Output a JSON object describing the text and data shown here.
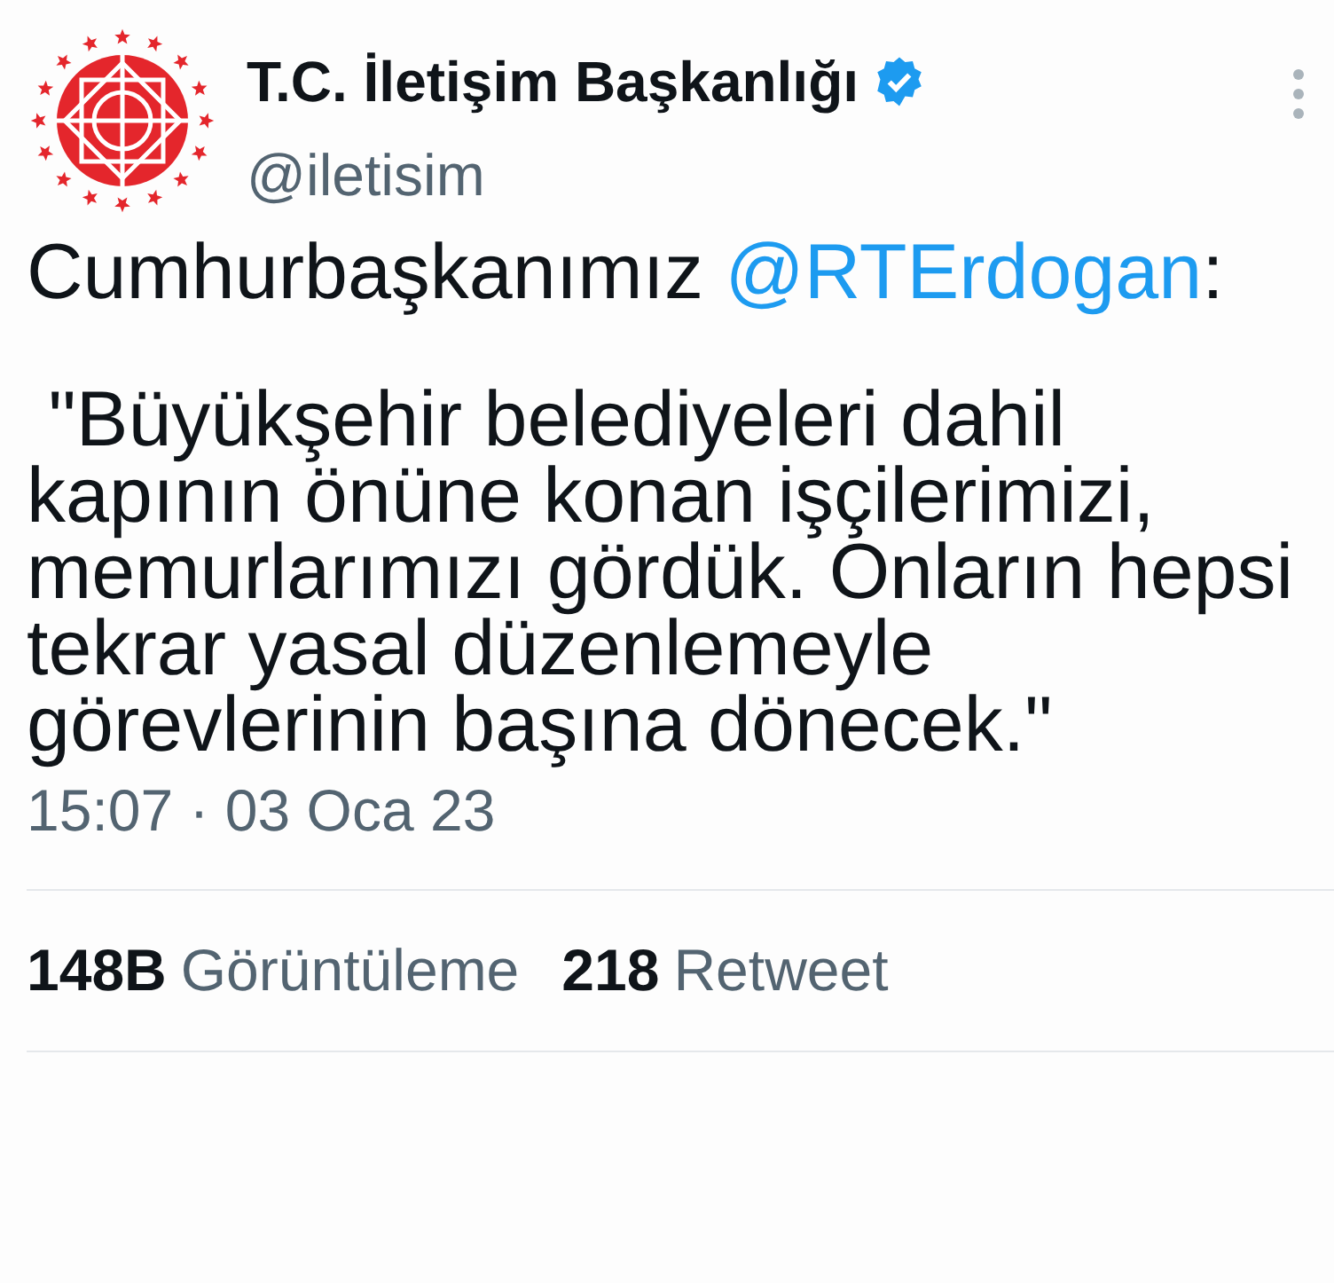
{
  "author": {
    "name": "T.C. İletişim Başkanlığı",
    "verified": true,
    "handle": "@iletisim"
  },
  "tweet": {
    "intro": "Cumhurbaşkanımız ",
    "mention": "@RTErdogan",
    "intro_end": ":",
    "quote": " \"Büyükşehir belediyeleri dahil kapının önüne konan işçilerimizi, memurlarımızı gördük. Onların hepsi tekrar yasal düzenlemeyle görevlerinin başına dönecek.\""
  },
  "timestamp": "15:07 · 03 Oca 23",
  "stats": [
    {
      "count": "148B",
      "label": "Görüntüleme"
    },
    {
      "count": "218",
      "label": "Retweet"
    }
  ]
}
